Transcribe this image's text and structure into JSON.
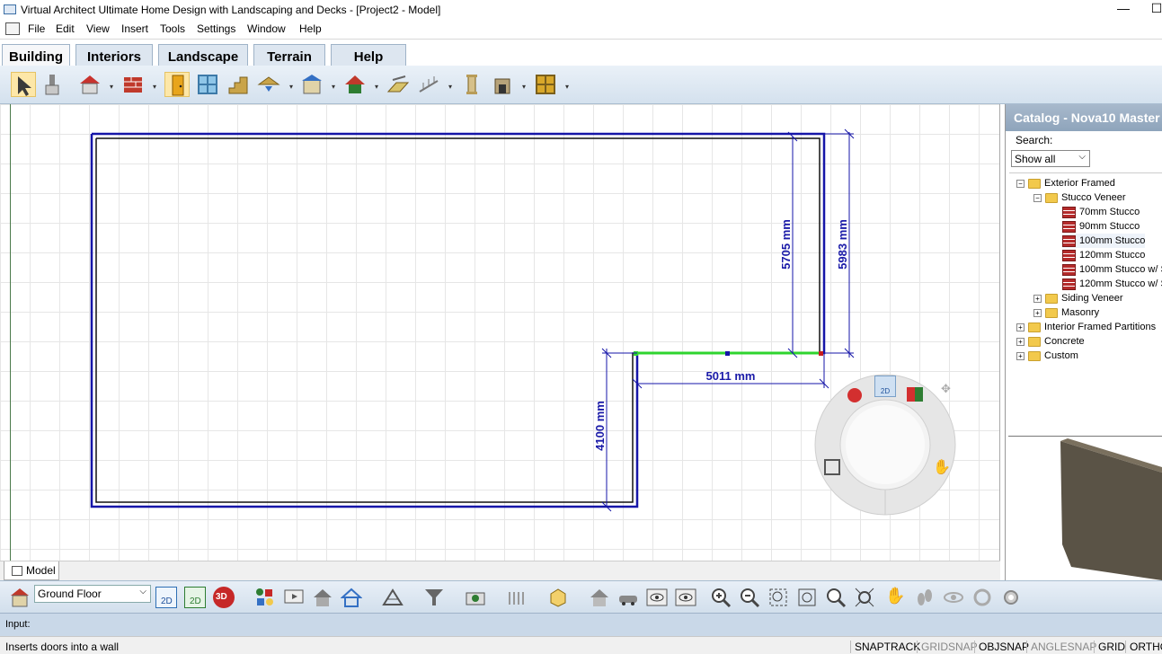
{
  "window": {
    "title": "Virtual Architect Ultimate Home Design with Landscaping and Decks - [Project2 - Model]",
    "minimize": "—",
    "maximize": "☐"
  },
  "menu": [
    "File",
    "Edit",
    "View",
    "Insert",
    "Tools",
    "Settings",
    "Window",
    "Help"
  ],
  "ribbon_tabs": [
    {
      "label": "Building",
      "active": true
    },
    {
      "label": "Interiors",
      "active": false
    },
    {
      "label": "Landscape",
      "active": false
    },
    {
      "label": "Terrain",
      "active": false
    },
    {
      "label": "Help",
      "active": false
    }
  ],
  "toolbar": {
    "tools": [
      "select-tool",
      "paint-tool",
      "wall-tool",
      "brick-wall-tool",
      "door-tool",
      "window-tool",
      "stairs-tool",
      "roof-tool",
      "dormer-tool",
      "roof-edit-tool",
      "floor-tool",
      "railing-tool",
      "column-tool",
      "fireplace-tool",
      "cabinet-tool"
    ]
  },
  "plan": {
    "dimensions": {
      "right_inner": "5705 mm",
      "right_outer": "5983 mm",
      "bottom_notch": "5011 mm",
      "left_notch": "4100 mm"
    }
  },
  "catalog": {
    "title": "Catalog - Nova10 Master",
    "search_label": "Search:",
    "filter": "Show all",
    "tree": [
      {
        "label": "Exterior Framed",
        "level": 0,
        "type": "folder",
        "expanded": true
      },
      {
        "label": "Stucco Veneer",
        "level": 1,
        "type": "folder",
        "expanded": true
      },
      {
        "label": "70mm Stucco",
        "level": 2,
        "type": "item"
      },
      {
        "label": "90mm Stucco",
        "level": 2,
        "type": "item"
      },
      {
        "label": "100mm Stucco",
        "level": 2,
        "type": "item",
        "selected": true
      },
      {
        "label": "120mm Stucco",
        "level": 2,
        "type": "item"
      },
      {
        "label": "100mm Stucco w/ S",
        "level": 2,
        "type": "item"
      },
      {
        "label": "120mm Stucco w/ S",
        "level": 2,
        "type": "item"
      },
      {
        "label": "Siding Veneer",
        "level": 1,
        "type": "folder",
        "expanded": false
      },
      {
        "label": "Masonry",
        "level": 1,
        "type": "folder",
        "expanded": false
      },
      {
        "label": "Interior Framed Partitions",
        "level": 0,
        "type": "folder",
        "expanded": false
      },
      {
        "label": "Concrete",
        "level": 0,
        "type": "folder",
        "expanded": false
      },
      {
        "label": "Custom",
        "level": 0,
        "type": "folder",
        "expanded": false
      }
    ]
  },
  "model_tab": "Model",
  "bottom": {
    "floor": "Ground Floor",
    "btn_2d": "2D",
    "btn_a2d": "2D",
    "btn_3d": "3D"
  },
  "nav_wheel": {
    "center_label": "2D"
  },
  "input_label": "Input:",
  "status": {
    "message": "Inserts doors into a wall",
    "toggles": [
      {
        "label": "SNAPTRACK",
        "on": true
      },
      {
        "label": "GRIDSNAP",
        "on": false
      },
      {
        "label": "OBJSNAP",
        "on": true
      },
      {
        "label": "ANGLESNAP",
        "on": false
      },
      {
        "label": "GRID",
        "on": true
      },
      {
        "label": "ORTHO",
        "on": true
      }
    ]
  },
  "colors": {
    "wall": "#1515a8",
    "selected_wall": "#2ed42e",
    "dimension": "#1a1aa8",
    "ribbon_bg": "#dde6f0"
  }
}
